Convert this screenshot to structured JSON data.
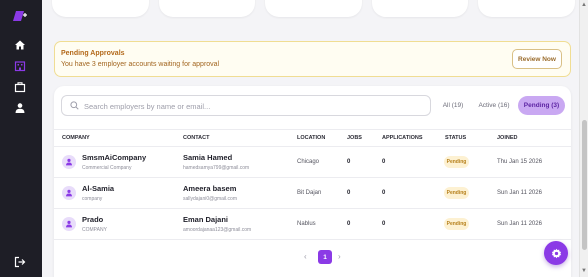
{
  "sidebar": {
    "logo": "app-logo",
    "items": [
      {
        "icon": "home-icon",
        "active": false
      },
      {
        "icon": "building-icon",
        "active": true
      },
      {
        "icon": "briefcase-icon",
        "active": false
      },
      {
        "icon": "user-icon",
        "active": false
      }
    ],
    "logout_icon": "logout-icon",
    "accent": "#8b3ae6",
    "background": "#1e1e26"
  },
  "alert": {
    "title": "Pending Approvals",
    "text": "You have 3 employer accounts waiting for approval",
    "button": "Review Now",
    "border_color": "#f0dd93",
    "text_color": "#b3691b"
  },
  "search": {
    "placeholder": "Search employers by name or email..."
  },
  "filters": [
    {
      "label": "All (19)",
      "active": false
    },
    {
      "label": "Active (16)",
      "active": false
    },
    {
      "label": "Pending (3)",
      "active": true
    }
  ],
  "table": {
    "headers": [
      "COMPANY",
      "CONTACT",
      "LOCATION",
      "JOBS",
      "APPLICATIONS",
      "STATUS",
      "JOINED"
    ],
    "rows": [
      {
        "company": "SmsmAiCompany",
        "company_type": "Commercial Company",
        "contact_name": "Samia Hamed",
        "contact_email": "hamedsamya799@gmail.com",
        "location": "Chicago",
        "jobs": "0",
        "applications": "0",
        "status": "Pending",
        "joined": "Thu Jan 15 2026"
      },
      {
        "company": "Al-Samia",
        "company_type": "company",
        "contact_name": "Ameera basem",
        "contact_email": "sallydajani0@gmail.com",
        "location": "Bit Dajan",
        "jobs": "0",
        "applications": "0",
        "status": "Pending",
        "joined": "Sun Jan 11 2026"
      },
      {
        "company": "Prado",
        "company_type": "COMPANY",
        "contact_name": "Eman Dajani",
        "contact_email": "amoordajanaa123@gmail.com",
        "location": "Nablus",
        "jobs": "0",
        "applications": "0",
        "status": "Pending",
        "joined": "Sun Jan 11 2026"
      }
    ]
  },
  "pagination": {
    "prev": "‹",
    "current": "1",
    "next": "›"
  },
  "fab": {
    "icon": "gear-icon"
  }
}
